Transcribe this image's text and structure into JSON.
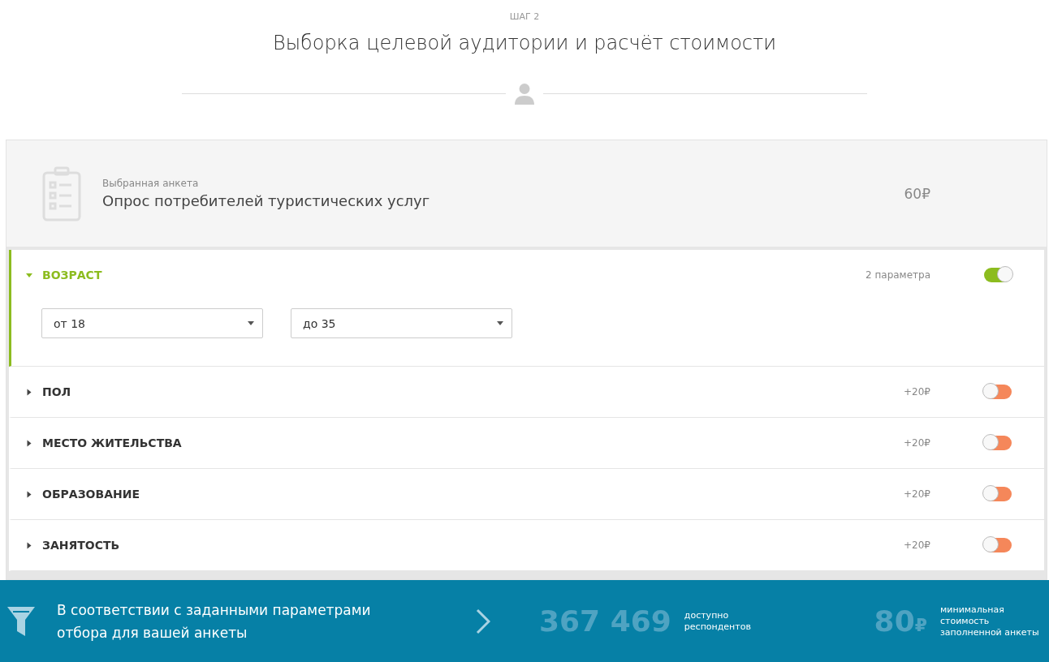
{
  "header": {
    "step": "ШАГ 2",
    "title": "Выборка целевой аудитории и расчёт стоимости"
  },
  "selected_survey": {
    "label": "Выбранная анкета",
    "name": "Опрос потребителей туристических услуг",
    "price": "60₽"
  },
  "filters": [
    {
      "label": "ВОЗРАСТ",
      "note": "2 параметра",
      "expanded": true,
      "on": true,
      "selects": [
        {
          "value": "от 18"
        },
        {
          "value": "до 35"
        }
      ]
    },
    {
      "label": "ПОЛ",
      "note": "+20₽",
      "expanded": false,
      "on": false
    },
    {
      "label": "МЕСТО ЖИТЕЛЬСТВА",
      "note": "+20₽",
      "expanded": false,
      "on": false
    },
    {
      "label": "ОБРАЗОВАНИЕ",
      "note": "+20₽",
      "expanded": false,
      "on": false
    },
    {
      "label": "ЗАНЯТОСТЬ",
      "note": "+20₽",
      "expanded": false,
      "on": false
    }
  ],
  "footer": {
    "message": "В соответствии с заданными параметрами отбора для вашей анкеты",
    "respondents": "367 469",
    "respondents_label": "доступно респондентов",
    "min_price": "80",
    "currency": "₽",
    "min_price_label": "минимальная стоимость заполненной анкеты"
  }
}
